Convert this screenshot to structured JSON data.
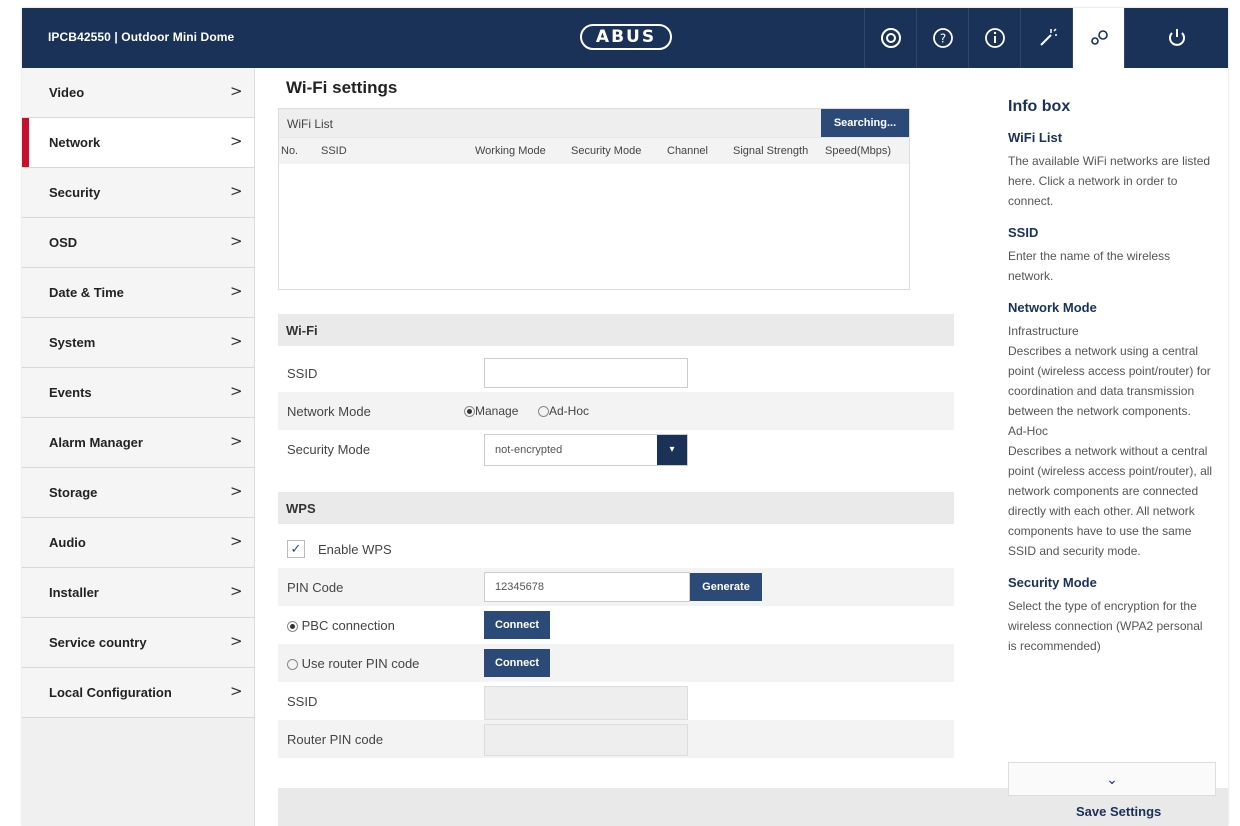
{
  "header": {
    "device_title": "IPCB42550 | Outdoor Mini Dome",
    "logo": "ABUS",
    "icons": [
      "camera-icon",
      "help-icon",
      "info-icon",
      "wand-icon",
      "settings-icon",
      "power-icon"
    ],
    "accent": "#1a3158"
  },
  "sidebar": {
    "items": [
      {
        "label": "Video",
        "chev": ">"
      },
      {
        "label": "Network",
        "chev": ">"
      },
      {
        "label": "Security",
        "chev": ">"
      },
      {
        "label": "OSD",
        "chev": ">"
      },
      {
        "label": "Date & Time",
        "chev": ">"
      },
      {
        "label": "System",
        "chev": ">"
      },
      {
        "label": "Events",
        "chev": ">"
      },
      {
        "label": "Alarm Manager",
        "chev": ">"
      },
      {
        "label": "Storage",
        "chev": ">"
      },
      {
        "label": "Audio",
        "chev": ">"
      },
      {
        "label": "Installer",
        "chev": ">"
      },
      {
        "label": "Service country",
        "chev": ">"
      },
      {
        "label": "Local Configuration",
        "chev": ">"
      }
    ],
    "active": "Network",
    "active_color": "#c8102e"
  },
  "main": {
    "title": "Wi-Fi settings",
    "wifi_list": {
      "title": "WiFi List",
      "search_button": "Searching...",
      "columns": [
        "No.",
        "SSID",
        "Working Mode",
        "Security Mode",
        "Channel",
        "Signal Strength",
        "Speed(Mbps)"
      ]
    },
    "wifi": {
      "section": "Wi-Fi",
      "ssid_label": "SSID",
      "ssid_value": "",
      "network_mode_label": "Network Mode",
      "mode_manage": "Manage",
      "mode_adhoc": "Ad-Hoc",
      "security_mode_label": "Security Mode",
      "security_mode_value": "not-encrypted"
    },
    "wps": {
      "section": "WPS",
      "enable_label": "Enable WPS",
      "enable_checked": true,
      "pin_label": "PIN Code",
      "pin_value": "12345678",
      "generate_button": "Generate",
      "pbc_label": "PBC connection",
      "router_pin_label": "Use router PIN code",
      "connect_button": "Connect",
      "ssid_label": "SSID",
      "router_pin_code_label": "Router PIN code"
    }
  },
  "infobox": {
    "title": "Info box",
    "sections": [
      {
        "heading": "WiFi List",
        "text": "The available WiFi networks are listed here. Click a network in order to connect."
      },
      {
        "heading": "SSID",
        "text": "Enter the name of the wireless network."
      },
      {
        "heading": "Network Mode",
        "text": "Infrastructure"
      },
      {
        "heading": "",
        "text": "Describes a network using a central point (wireless access point/router) for coordination and data transmission between the network components."
      },
      {
        "heading": "",
        "text": "Ad-Hoc"
      },
      {
        "heading": "",
        "text": "Describes a network without a central point (wireless access point/router), all network components are connected directly with each other. All network components have to use the same SSID and security mode."
      },
      {
        "heading": "Security Mode",
        "text": "Select the type of encryption for the wireless connection (WPA2 personal is recommended)"
      }
    ],
    "save_button": "Save Settings"
  }
}
